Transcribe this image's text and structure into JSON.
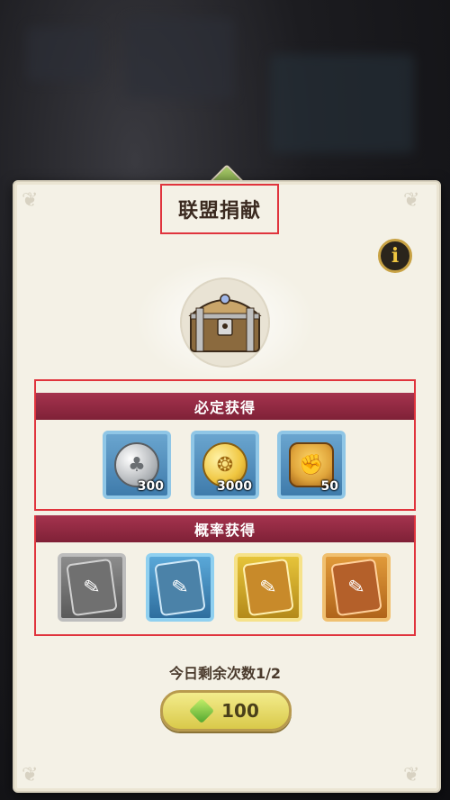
{
  "title": "联盟捐献",
  "info_label": "i",
  "sections": {
    "guaranteed": {
      "label": "必定获得",
      "items": [
        {
          "icon": "silver-clover-coin-icon",
          "qty": "300",
          "color": "#bfc3c7"
        },
        {
          "icon": "gold-coin-icon",
          "qty": "3000",
          "color": "#f0c640"
        },
        {
          "icon": "fist-badge-icon",
          "qty": "50",
          "color": "#e0a53b"
        }
      ]
    },
    "chance": {
      "label": "概率获得",
      "items": [
        {
          "icon": "gray-card-icon",
          "rarity": "gray"
        },
        {
          "icon": "blue-card-icon",
          "rarity": "blue"
        },
        {
          "icon": "gold-card-icon",
          "rarity": "gold"
        },
        {
          "icon": "orange-card-icon",
          "rarity": "orange"
        }
      ]
    }
  },
  "remaining_text": "今日剩余次数1/2",
  "cost": {
    "value": "100",
    "icon": "green-gem-icon"
  }
}
